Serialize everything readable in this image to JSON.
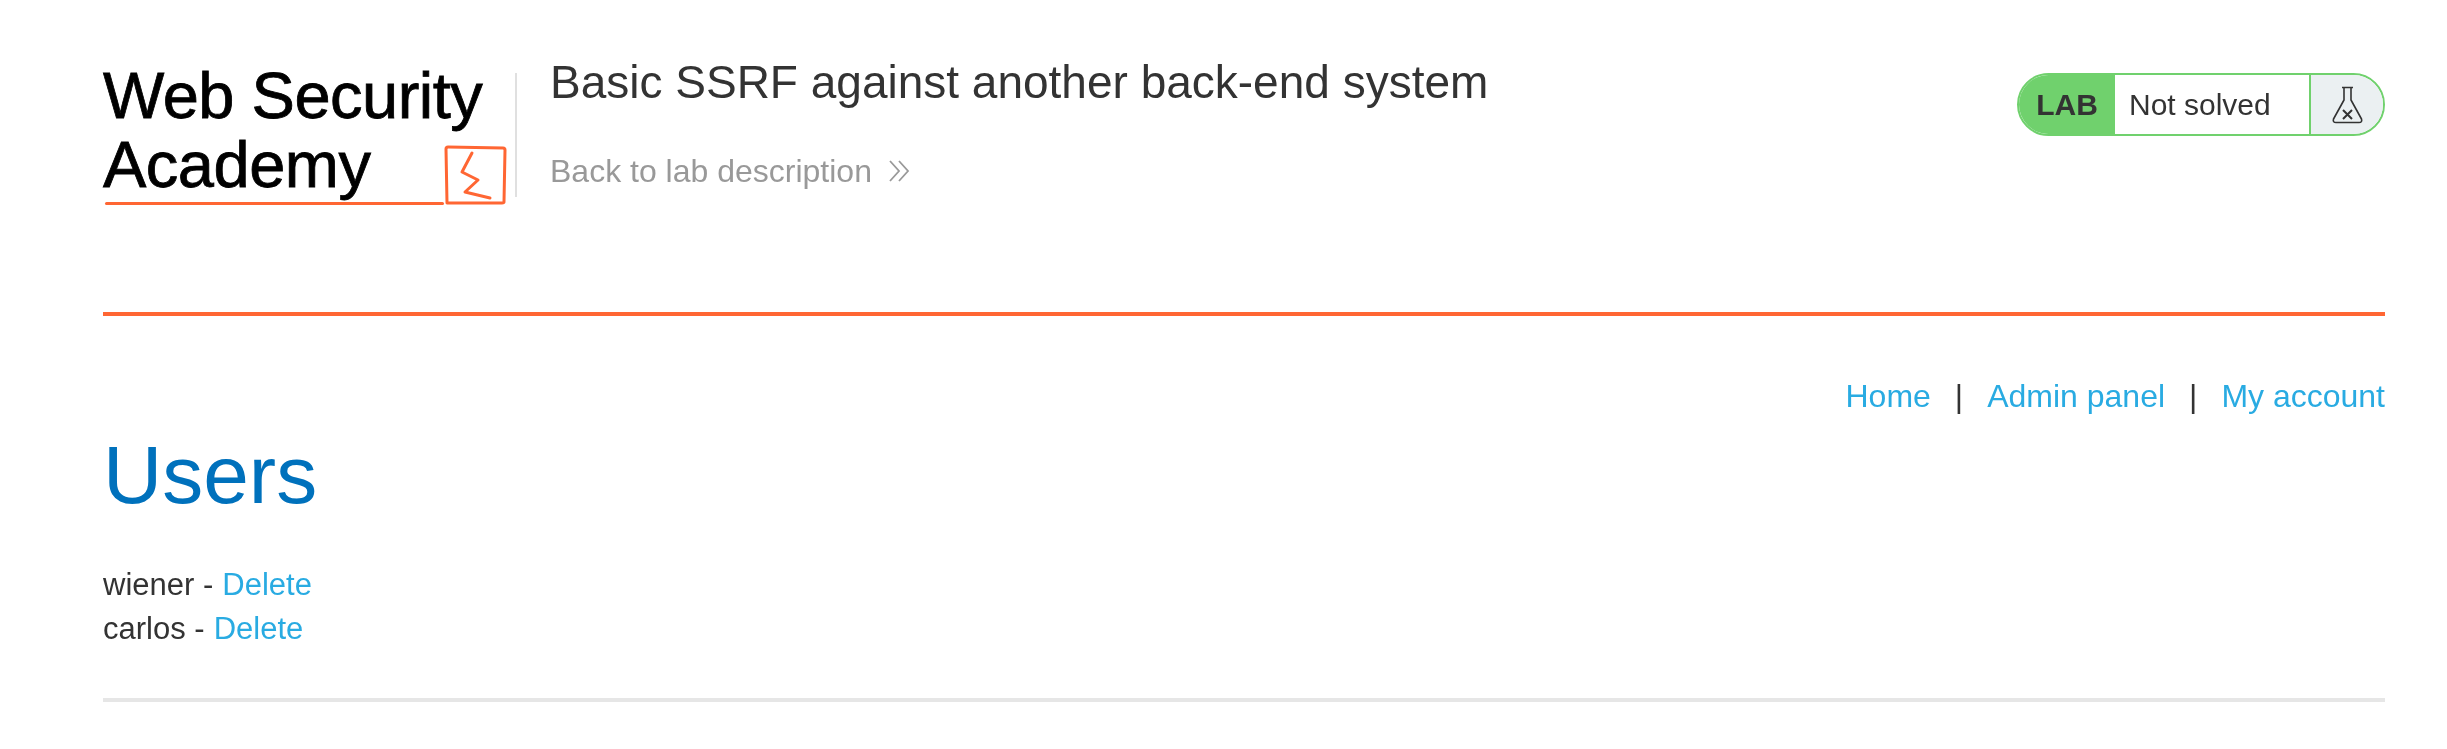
{
  "logo": {
    "lines": [
      "Web Security",
      "Academy"
    ]
  },
  "header": {
    "title": "Basic SSRF against another back-end system",
    "back_link": "Back to lab description"
  },
  "lab_status": {
    "label": "LAB",
    "status": "Not solved",
    "solved": false
  },
  "nav": [
    {
      "kind": "link",
      "label": "Home"
    },
    {
      "kind": "separator",
      "label": "|"
    },
    {
      "kind": "link",
      "label": "Admin panel"
    },
    {
      "kind": "separator",
      "label": "|"
    },
    {
      "kind": "link",
      "label": "My account"
    }
  ],
  "heading": "Users",
  "users": [
    {
      "label": "wiener -",
      "action": "Delete"
    },
    {
      "label": "carlos -",
      "action": "Delete"
    }
  ]
}
